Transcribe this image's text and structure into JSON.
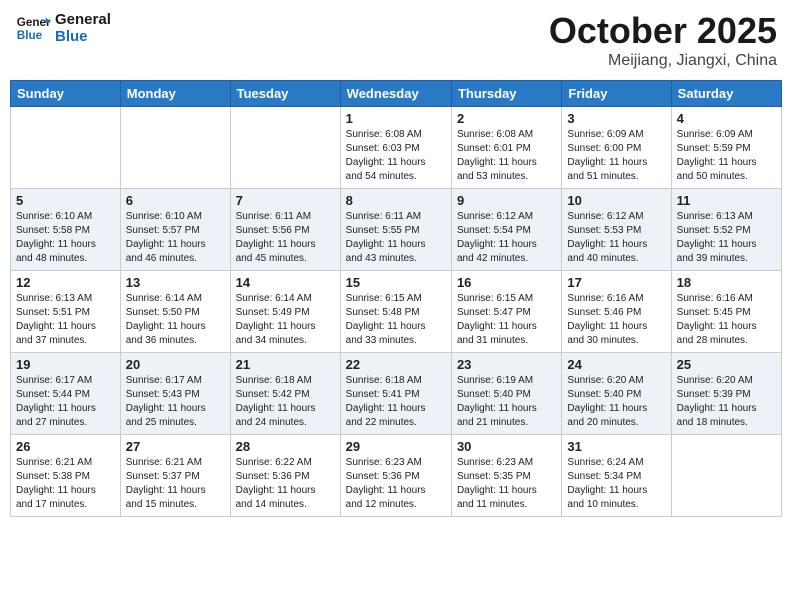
{
  "header": {
    "logo_line1": "General",
    "logo_line2": "Blue",
    "month": "October 2025",
    "location": "Meijiang, Jiangxi, China"
  },
  "days_of_week": [
    "Sunday",
    "Monday",
    "Tuesday",
    "Wednesday",
    "Thursday",
    "Friday",
    "Saturday"
  ],
  "weeks": [
    [
      {
        "day": "",
        "info": ""
      },
      {
        "day": "",
        "info": ""
      },
      {
        "day": "",
        "info": ""
      },
      {
        "day": "1",
        "info": "Sunrise: 6:08 AM\nSunset: 6:03 PM\nDaylight: 11 hours\nand 54 minutes."
      },
      {
        "day": "2",
        "info": "Sunrise: 6:08 AM\nSunset: 6:01 PM\nDaylight: 11 hours\nand 53 minutes."
      },
      {
        "day": "3",
        "info": "Sunrise: 6:09 AM\nSunset: 6:00 PM\nDaylight: 11 hours\nand 51 minutes."
      },
      {
        "day": "4",
        "info": "Sunrise: 6:09 AM\nSunset: 5:59 PM\nDaylight: 11 hours\nand 50 minutes."
      }
    ],
    [
      {
        "day": "5",
        "info": "Sunrise: 6:10 AM\nSunset: 5:58 PM\nDaylight: 11 hours\nand 48 minutes."
      },
      {
        "day": "6",
        "info": "Sunrise: 6:10 AM\nSunset: 5:57 PM\nDaylight: 11 hours\nand 46 minutes."
      },
      {
        "day": "7",
        "info": "Sunrise: 6:11 AM\nSunset: 5:56 PM\nDaylight: 11 hours\nand 45 minutes."
      },
      {
        "day": "8",
        "info": "Sunrise: 6:11 AM\nSunset: 5:55 PM\nDaylight: 11 hours\nand 43 minutes."
      },
      {
        "day": "9",
        "info": "Sunrise: 6:12 AM\nSunset: 5:54 PM\nDaylight: 11 hours\nand 42 minutes."
      },
      {
        "day": "10",
        "info": "Sunrise: 6:12 AM\nSunset: 5:53 PM\nDaylight: 11 hours\nand 40 minutes."
      },
      {
        "day": "11",
        "info": "Sunrise: 6:13 AM\nSunset: 5:52 PM\nDaylight: 11 hours\nand 39 minutes."
      }
    ],
    [
      {
        "day": "12",
        "info": "Sunrise: 6:13 AM\nSunset: 5:51 PM\nDaylight: 11 hours\nand 37 minutes."
      },
      {
        "day": "13",
        "info": "Sunrise: 6:14 AM\nSunset: 5:50 PM\nDaylight: 11 hours\nand 36 minutes."
      },
      {
        "day": "14",
        "info": "Sunrise: 6:14 AM\nSunset: 5:49 PM\nDaylight: 11 hours\nand 34 minutes."
      },
      {
        "day": "15",
        "info": "Sunrise: 6:15 AM\nSunset: 5:48 PM\nDaylight: 11 hours\nand 33 minutes."
      },
      {
        "day": "16",
        "info": "Sunrise: 6:15 AM\nSunset: 5:47 PM\nDaylight: 11 hours\nand 31 minutes."
      },
      {
        "day": "17",
        "info": "Sunrise: 6:16 AM\nSunset: 5:46 PM\nDaylight: 11 hours\nand 30 minutes."
      },
      {
        "day": "18",
        "info": "Sunrise: 6:16 AM\nSunset: 5:45 PM\nDaylight: 11 hours\nand 28 minutes."
      }
    ],
    [
      {
        "day": "19",
        "info": "Sunrise: 6:17 AM\nSunset: 5:44 PM\nDaylight: 11 hours\nand 27 minutes."
      },
      {
        "day": "20",
        "info": "Sunrise: 6:17 AM\nSunset: 5:43 PM\nDaylight: 11 hours\nand 25 minutes."
      },
      {
        "day": "21",
        "info": "Sunrise: 6:18 AM\nSunset: 5:42 PM\nDaylight: 11 hours\nand 24 minutes."
      },
      {
        "day": "22",
        "info": "Sunrise: 6:18 AM\nSunset: 5:41 PM\nDaylight: 11 hours\nand 22 minutes."
      },
      {
        "day": "23",
        "info": "Sunrise: 6:19 AM\nSunset: 5:40 PM\nDaylight: 11 hours\nand 21 minutes."
      },
      {
        "day": "24",
        "info": "Sunrise: 6:20 AM\nSunset: 5:40 PM\nDaylight: 11 hours\nand 20 minutes."
      },
      {
        "day": "25",
        "info": "Sunrise: 6:20 AM\nSunset: 5:39 PM\nDaylight: 11 hours\nand 18 minutes."
      }
    ],
    [
      {
        "day": "26",
        "info": "Sunrise: 6:21 AM\nSunset: 5:38 PM\nDaylight: 11 hours\nand 17 minutes."
      },
      {
        "day": "27",
        "info": "Sunrise: 6:21 AM\nSunset: 5:37 PM\nDaylight: 11 hours\nand 15 minutes."
      },
      {
        "day": "28",
        "info": "Sunrise: 6:22 AM\nSunset: 5:36 PM\nDaylight: 11 hours\nand 14 minutes."
      },
      {
        "day": "29",
        "info": "Sunrise: 6:23 AM\nSunset: 5:36 PM\nDaylight: 11 hours\nand 12 minutes."
      },
      {
        "day": "30",
        "info": "Sunrise: 6:23 AM\nSunset: 5:35 PM\nDaylight: 11 hours\nand 11 minutes."
      },
      {
        "day": "31",
        "info": "Sunrise: 6:24 AM\nSunset: 5:34 PM\nDaylight: 11 hours\nand 10 minutes."
      },
      {
        "day": "",
        "info": ""
      }
    ]
  ]
}
